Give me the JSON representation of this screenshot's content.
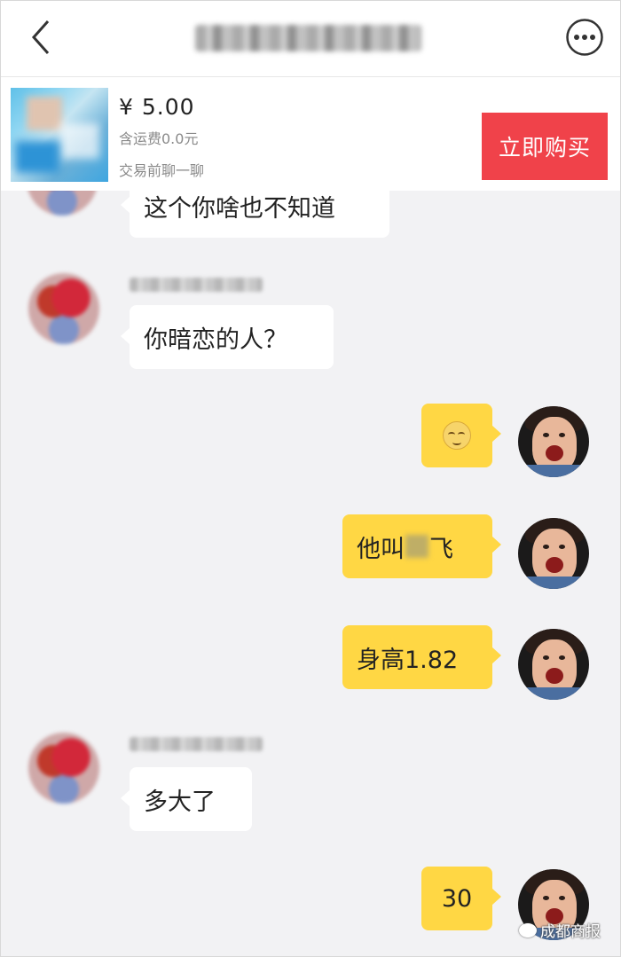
{
  "product": {
    "price": "¥ 5.00",
    "shipping": "含运费0.0元",
    "chat_hint": "交易前聊一聊",
    "buy_label": "立即购买"
  },
  "messages": [
    {
      "side": "left",
      "text": "这个你啥也不知道"
    },
    {
      "side": "left",
      "text": "你暗恋的人？"
    },
    {
      "side": "right",
      "icon": "squinting-face-emoji"
    },
    {
      "side": "right",
      "text_before": "他叫",
      "text_after": "飞"
    },
    {
      "side": "right",
      "text": "身高1.82"
    },
    {
      "side": "left",
      "text": "多大了"
    },
    {
      "side": "right",
      "text": "30"
    }
  ],
  "watermark": {
    "text": "成都商报"
  }
}
